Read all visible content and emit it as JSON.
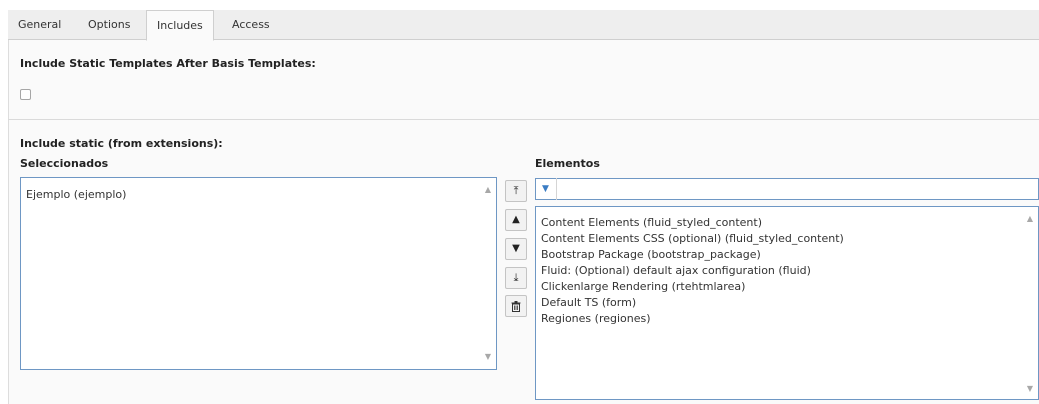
{
  "tabs": [
    {
      "label": "General"
    },
    {
      "label": "Options"
    },
    {
      "label": "Includes"
    },
    {
      "label": "Access"
    }
  ],
  "active_tab": "Includes",
  "include_static_after_basis": {
    "label": "Include Static Templates After Basis Templates:",
    "checked": false
  },
  "include_static": {
    "label": "Include static (from extensions):",
    "selected": {
      "heading": "Seleccionados",
      "items": [
        "Ejemplo (ejemplo)"
      ]
    },
    "available": {
      "heading": "Elementos",
      "filter_value": "",
      "items": [
        "Content Elements (fluid_styled_content)",
        "Content Elements CSS (optional) (fluid_styled_content)",
        "Bootstrap Package (bootstrap_package)",
        "Fluid: (Optional) default ajax configuration (fluid)",
        "Clickenlarge Rendering (rtehtmlarea)",
        "Default TS (form)",
        "Regiones (regiones)"
      ]
    }
  },
  "controls": {
    "move_top": "⏫",
    "move_up": "▲",
    "move_down": "▼",
    "move_bottom": "⏬",
    "remove": "🗑"
  }
}
